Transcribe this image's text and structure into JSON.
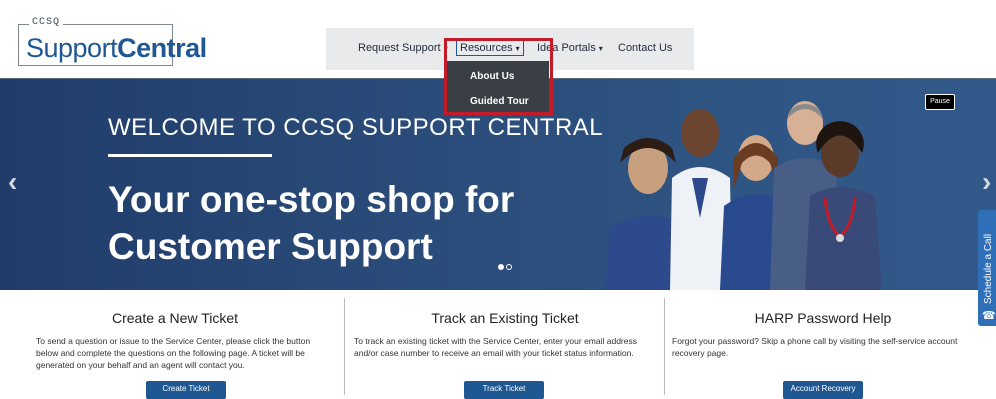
{
  "logo": {
    "small_text": "CCSQ",
    "main_text_regular": "Support",
    "main_text_bold": "Central"
  },
  "nav": {
    "items": [
      {
        "label": "Request Support",
        "caret": "▾"
      },
      {
        "label": "Resources",
        "caret": "▾"
      },
      {
        "label": "Idea Portals",
        "caret": "▾"
      },
      {
        "label": "Contact Us"
      }
    ],
    "dropdown": [
      {
        "label": "About Us"
      },
      {
        "label": "Guided Tour"
      }
    ]
  },
  "hero": {
    "welcome": "WELCOME TO CCSQ SUPPORT CENTRAL",
    "headline_line1": "Your one-stop shop for",
    "headline_line2": "Customer Support",
    "pause_label": "Pause",
    "prev_arrow": "‹",
    "next_arrow": "›",
    "schedule_label": "Schedule a Call",
    "schedule_icon": "☎",
    "slide_index": 1,
    "slide_count": 2
  },
  "cards": [
    {
      "title": "Create a New Ticket",
      "text": "To send a question or issue to the Service Center, please click the button below and complete the questions on the following page. A ticket will be generated on your behalf and an agent will contact you.",
      "button": "Create Ticket"
    },
    {
      "title": "Track an Existing Ticket",
      "text": "To track an existing ticket with the Service Center, enter your email address and/or case number to receive an email with your ticket status information.",
      "button": "Track Ticket"
    },
    {
      "title": "HARP Password Help",
      "text": "Forgot your password? Skip a phone call by visiting the self-service account recovery page.",
      "button": "Account Recovery"
    }
  ],
  "colors": {
    "brand": "#1f5792",
    "hero_bg": "#2a4b79",
    "highlight": "#c41b28",
    "nav_bg": "#e9eaec",
    "dropdown_bg": "#3a3f45"
  }
}
